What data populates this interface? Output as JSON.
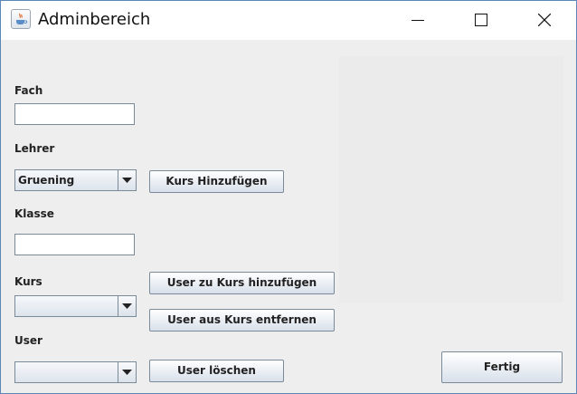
{
  "window": {
    "title": "Adminbereich",
    "icon": "java-cup-icon",
    "controls": [
      "minimize-icon",
      "maximize-icon",
      "close-icon"
    ]
  },
  "form": {
    "fach_label": "Fach",
    "fach_value": "",
    "lehrer_label": "Lehrer",
    "lehrer_selected": "Gruening",
    "kurs_hinzufuegen_label": "Kurs Hinzufügen",
    "klasse_label": "Klasse",
    "klasse_value": "",
    "kurs_label": "Kurs",
    "kurs_selected": "",
    "user_zu_kurs_label": "User zu Kurs hinzufügen",
    "user_aus_kurs_label": "User aus Kurs entfernen",
    "user_label": "User",
    "user_selected": "",
    "user_loeschen_label": "User löschen",
    "fertig_label": "Fertig"
  },
  "colors": {
    "window_bg": "#eeeeee",
    "titlebar_bg": "#ffffff",
    "border": "#5c86b8"
  }
}
